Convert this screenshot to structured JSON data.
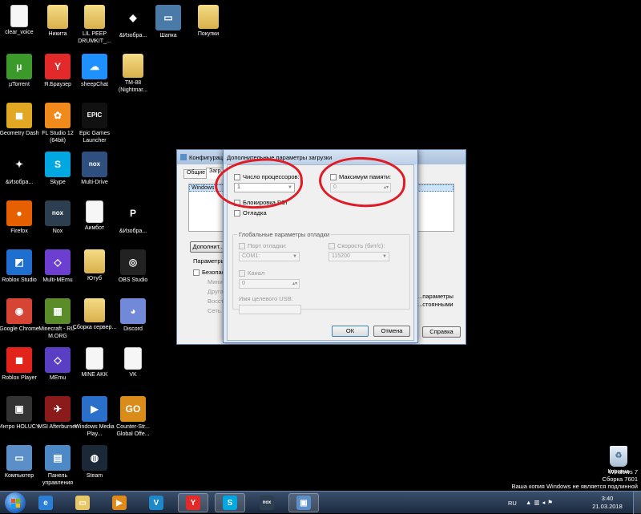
{
  "desktop": {
    "icons": [
      {
        "label": "clear_voice",
        "kind": "doc",
        "glyph": "",
        "color": "#f6f6f6"
      },
      {
        "label": "Никита",
        "kind": "folder",
        "glyph": "",
        "color": "#e8c766"
      },
      {
        "label": "LIL PEEP DRUMKIT_...",
        "kind": "folder",
        "glyph": "",
        "color": "#e8c766"
      },
      {
        "label": "&Изобра...",
        "kind": "app",
        "glyph": "◆",
        "color": "#000000"
      },
      {
        "label": "Шапка",
        "kind": "app",
        "glyph": "▭",
        "color": "#4a7ba8"
      },
      {
        "label": "Покупки",
        "kind": "folder",
        "glyph": "",
        "color": "#e8c766"
      },
      {
        "label": "µTorrent",
        "kind": "app",
        "glyph": "µ",
        "color": "#3c9a2a"
      },
      {
        "label": "Я.Браузер",
        "kind": "app",
        "glyph": "Y",
        "color": "#e22a2a"
      },
      {
        "label": "sheepChat",
        "kind": "app",
        "glyph": "☁",
        "color": "#1e90ff"
      },
      {
        "label": "TM-88 (Nightmar...",
        "kind": "folder",
        "glyph": "",
        "color": "#e8c766"
      },
      {
        "label": "Geometry Dash",
        "kind": "app",
        "glyph": "◼",
        "color": "#e3a823"
      },
      {
        "label": "FL Studio 12 (64bit)",
        "kind": "app",
        "glyph": "✿",
        "color": "#f08a1c"
      },
      {
        "label": "Epic Games Launcher",
        "kind": "app",
        "glyph": "EPIC",
        "color": "#111111"
      },
      {
        "label": "&Изобра...",
        "kind": "app",
        "glyph": "✦",
        "color": "#000000"
      },
      {
        "label": "Skype",
        "kind": "app",
        "glyph": "S",
        "color": "#00a7e1"
      },
      {
        "label": "Multi-Drive",
        "kind": "app",
        "glyph": "nox",
        "color": "#2f4f7f"
      },
      {
        "label": "Firefox",
        "kind": "app",
        "glyph": "●",
        "color": "#e66000"
      },
      {
        "label": "Nox",
        "kind": "app",
        "glyph": "nox",
        "color": "#2c3e50"
      },
      {
        "label": "Аимбот",
        "kind": "doc",
        "glyph": "",
        "color": "#f6f6f6"
      },
      {
        "label": "&Изобра...",
        "kind": "app",
        "glyph": "P",
        "color": "#000000"
      },
      {
        "label": "Roblox Studio",
        "kind": "app",
        "glyph": "◩",
        "color": "#1f6fd1"
      },
      {
        "label": "Multi-MEmu",
        "kind": "app",
        "glyph": "◇",
        "color": "#6c3fd1"
      },
      {
        "label": "Ютуб",
        "kind": "folder",
        "glyph": "",
        "color": "#e8c766"
      },
      {
        "label": "OBS Studio",
        "kind": "app",
        "glyph": "◎",
        "color": "#222222"
      },
      {
        "label": "Google Chrome",
        "kind": "app",
        "glyph": "◉",
        "color": "#d64434"
      },
      {
        "label": "Minecraft - RU-M.ORG",
        "kind": "app",
        "glyph": "▦",
        "color": "#5a8c2a"
      },
      {
        "label": "Сборка сервер...",
        "kind": "folder",
        "glyph": "",
        "color": "#e8c766"
      },
      {
        "label": "Discord",
        "kind": "app",
        "glyph": "◕",
        "color": "#7289da"
      },
      {
        "label": "Roblox Player",
        "kind": "app",
        "glyph": "◼",
        "color": "#e2231a"
      },
      {
        "label": "MEmu",
        "kind": "app",
        "glyph": "◇",
        "color": "#5a3fc4"
      },
      {
        "label": "MINE AKK",
        "kind": "doc",
        "glyph": "",
        "color": "#f6f6f6"
      },
      {
        "label": "VK",
        "kind": "doc",
        "glyph": "",
        "color": "#f6f6f6"
      },
      {
        "label": "Интро HOLUCY",
        "kind": "app",
        "glyph": "▣",
        "color": "#333333"
      },
      {
        "label": "MSI Afterburner",
        "kind": "app",
        "glyph": "✈",
        "color": "#8b1a1a"
      },
      {
        "label": "Windows Media Play...",
        "kind": "app",
        "glyph": "▶",
        "color": "#2a6fc9"
      },
      {
        "label": "Counter-Str... Global Offe...",
        "kind": "app",
        "glyph": "GO",
        "color": "#d98c1a"
      },
      {
        "label": "Компьютер",
        "kind": "app",
        "glyph": "▭",
        "color": "#5b8fc9"
      },
      {
        "label": "Панель управления",
        "kind": "app",
        "glyph": "▤",
        "color": "#4b8ac7"
      },
      {
        "label": "Steam",
        "kind": "app",
        "glyph": "◍",
        "color": "#1b2838"
      }
    ],
    "recycle_label": "Корзина",
    "watermark": [
      "Windows 7",
      "Сборка 7601",
      "Ваша копия Windows не является подлинной"
    ]
  },
  "bg_window": {
    "title": "Конфигурац...",
    "tabs": [
      "Общие",
      "Загр..."
    ],
    "list_item": "Windows",
    "advanced_button": "Дополнит...",
    "params_label": "Параметры...",
    "safe_label": "Безопас...",
    "radio_labels": [
      "Миним...",
      "Друга...",
      "Восст...",
      "Сеть..."
    ],
    "right_text": [
      "...параметры",
      "...стоянными"
    ],
    "help_button": "Справка"
  },
  "dialog": {
    "title": "Дополнительные параметры загрузки",
    "cpu_label": "Число процессоров:",
    "cpu_value": "1",
    "memory_label": "Максимум памяти:",
    "memory_value": "0",
    "pci_label": "Блокировка PCI",
    "debug_label": "Отладка",
    "global_group": "Глобальные параметры отладки",
    "debug_port_label": "Порт отладки:",
    "debug_port_value": "COM1:",
    "baud_label": "Скорость (бит/с):",
    "baud_value": "115200",
    "channel_label": "Канал",
    "channel_value": "0",
    "usb_label": "Имя целевого USB:",
    "usb_value": "",
    "ok_button": "ОК",
    "cancel_button": "Отмена"
  },
  "taskbar": {
    "apps": [
      {
        "name": "ie",
        "glyph": "e",
        "color": "#2a7fd4"
      },
      {
        "name": "explorer",
        "glyph": "▭",
        "color": "#e8c766"
      },
      {
        "name": "media",
        "glyph": "▶",
        "color": "#e08a1c"
      },
      {
        "name": "vegas",
        "glyph": "V",
        "color": "#1e88c8"
      },
      {
        "name": "yandex",
        "glyph": "Y",
        "color": "#e22a2a"
      },
      {
        "name": "skype",
        "glyph": "S",
        "color": "#00a7e1"
      },
      {
        "name": "nox",
        "glyph": "nox",
        "color": "#2c3e50"
      },
      {
        "name": "msconfig",
        "glyph": "▣",
        "color": "#5b8fc9"
      }
    ],
    "lang": "RU",
    "time": "3:40",
    "date": "21.03.2018"
  }
}
